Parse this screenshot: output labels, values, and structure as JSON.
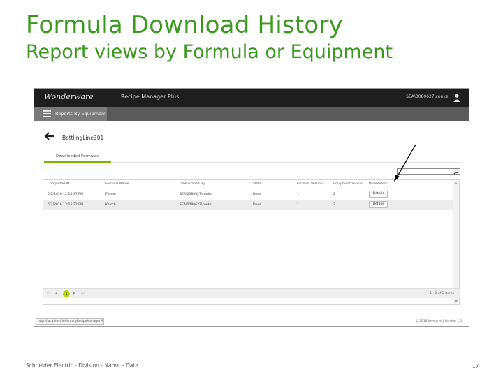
{
  "slide": {
    "title": "Formula Download History",
    "subtitle": "Report views by Formula or Equipment",
    "footer": "Schneider Electric - Division - Name – Date",
    "page_number": "17"
  },
  "app": {
    "logo_text": "Wonderware",
    "title": "Recipe Manager Plus",
    "user": "SEA\\0080627\\conks",
    "user_icon": "person-icon",
    "menu_label": "Reports By Equipment",
    "menu_icon": "hamburger-icon",
    "back_icon": "arrow-left-icon",
    "equipment_name": "BottlingLine301",
    "tab_label": "Downloaded Formulas",
    "search_placeholder": "",
    "search_icon": "magnifier-icon",
    "accent_color": "#7ab800"
  },
  "grid": {
    "columns": [
      "Completed At",
      "Formula Name",
      "Downloaded By",
      "State",
      "Formula Version",
      "Equipment Version",
      "Parameters"
    ],
    "rows": [
      {
        "completed_at": "6/2/2016 12:15:37 PM",
        "formula_name": "Pilsner",
        "downloaded_by": "SEA\\0080627\\conks",
        "state": "Done",
        "formula_version": "1",
        "equipment_version": "2",
        "action": "Details"
      },
      {
        "completed_at": "6/2/2016 12:15:22 PM",
        "formula_name": "Kolsch",
        "downloaded_by": "SEA\\0080627\\conks",
        "state": "Done",
        "formula_version": "1",
        "equipment_version": "2",
        "action": "Details"
      }
    ]
  },
  "pager": {
    "first": "⏮",
    "prev": "◀",
    "current": "1",
    "next": "▶",
    "last": "⏭",
    "info": "1 - 2 of 2 items"
  },
  "status": {
    "url": "http://localhost/InVentoryRecipeManagerPlus/#",
    "copyright": "© 2016 Invensys | Version 1.0"
  }
}
